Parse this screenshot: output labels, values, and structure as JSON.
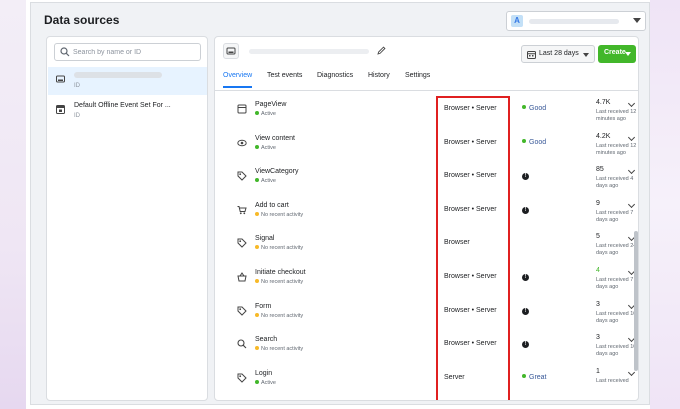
{
  "page_title": "Data sources",
  "account": {
    "avatar_letter": "A"
  },
  "search": {
    "placeholder": "Search by name or ID"
  },
  "sources": [
    {
      "name": "",
      "id_label": "ID",
      "icon": "pixel-icon",
      "selected": true
    },
    {
      "name": "Default Offline Event Set For ...",
      "id_label": "ID",
      "icon": "offline-event-set-icon",
      "selected": false
    }
  ],
  "header": {
    "date_range": "Last 28 days",
    "create_label": "Create"
  },
  "tabs": [
    {
      "label": "Overview",
      "active": true
    },
    {
      "label": "Test events",
      "active": false
    },
    {
      "label": "Diagnostics",
      "active": false
    },
    {
      "label": "History",
      "active": false
    },
    {
      "label": "Settings",
      "active": false
    }
  ],
  "events": [
    {
      "name": "PageView",
      "status": "Active",
      "status_color": "#42b72a",
      "connection": "Browser • Server",
      "quality": "Good",
      "quality_icon": "green-dot",
      "count": "4.7K",
      "count_color": "#1c1e21",
      "last_received": "Last received 12 minutes ago",
      "icon": "page-icon"
    },
    {
      "name": "View content",
      "status": "Active",
      "status_color": "#42b72a",
      "connection": "Browser • Server",
      "quality": "Good",
      "quality_icon": "green-dot",
      "count": "4.2K",
      "count_color": "#1c1e21",
      "last_received": "Last received 12 minutes ago",
      "icon": "eye-icon"
    },
    {
      "name": "ViewCategory",
      "status": "Active",
      "status_color": "#42b72a",
      "connection": "Browser • Server",
      "quality": "",
      "quality_icon": "info",
      "count": "85",
      "count_color": "#1c1e21",
      "last_received": "Last received 4 days ago",
      "icon": "tag-icon"
    },
    {
      "name": "Add to cart",
      "status": "No recent activity",
      "status_color": "#f7b928",
      "connection": "Browser • Server",
      "quality": "",
      "quality_icon": "info",
      "count": "9",
      "count_color": "#1c1e21",
      "last_received": "Last received 7 days ago",
      "icon": "cart-icon"
    },
    {
      "name": "Signal",
      "status": "No recent activity",
      "status_color": "#f7b928",
      "connection": "Browser",
      "quality": "",
      "quality_icon": "none",
      "count": "5",
      "count_color": "#1c1e21",
      "last_received": "Last received 24 days ago",
      "icon": "tag-icon"
    },
    {
      "name": "Initiate checkout",
      "status": "No recent activity",
      "status_color": "#f7b928",
      "connection": "Browser • Server",
      "quality": "",
      "quality_icon": "info",
      "count": "4",
      "count_color": "#42b72a",
      "last_received": "Last received 7 days ago",
      "icon": "basket-icon"
    },
    {
      "name": "Form",
      "status": "No recent activity",
      "status_color": "#f7b928",
      "connection": "Browser • Server",
      "quality": "",
      "quality_icon": "info",
      "count": "3",
      "count_color": "#1c1e21",
      "last_received": "Last received 10 days ago",
      "icon": "tag-icon"
    },
    {
      "name": "Search",
      "status": "No recent activity",
      "status_color": "#f7b928",
      "connection": "Browser • Server",
      "quality": "",
      "quality_icon": "info",
      "count": "3",
      "count_color": "#1c1e21",
      "last_received": "Last received 10 days ago",
      "icon": "search-icon"
    },
    {
      "name": "Login",
      "status": "Active",
      "status_color": "#42b72a",
      "connection": "Server",
      "quality": "Great",
      "quality_icon": "green-dot",
      "count": "1",
      "count_color": "#1c1e21",
      "last_received": "Last received",
      "icon": "tag-icon"
    }
  ]
}
